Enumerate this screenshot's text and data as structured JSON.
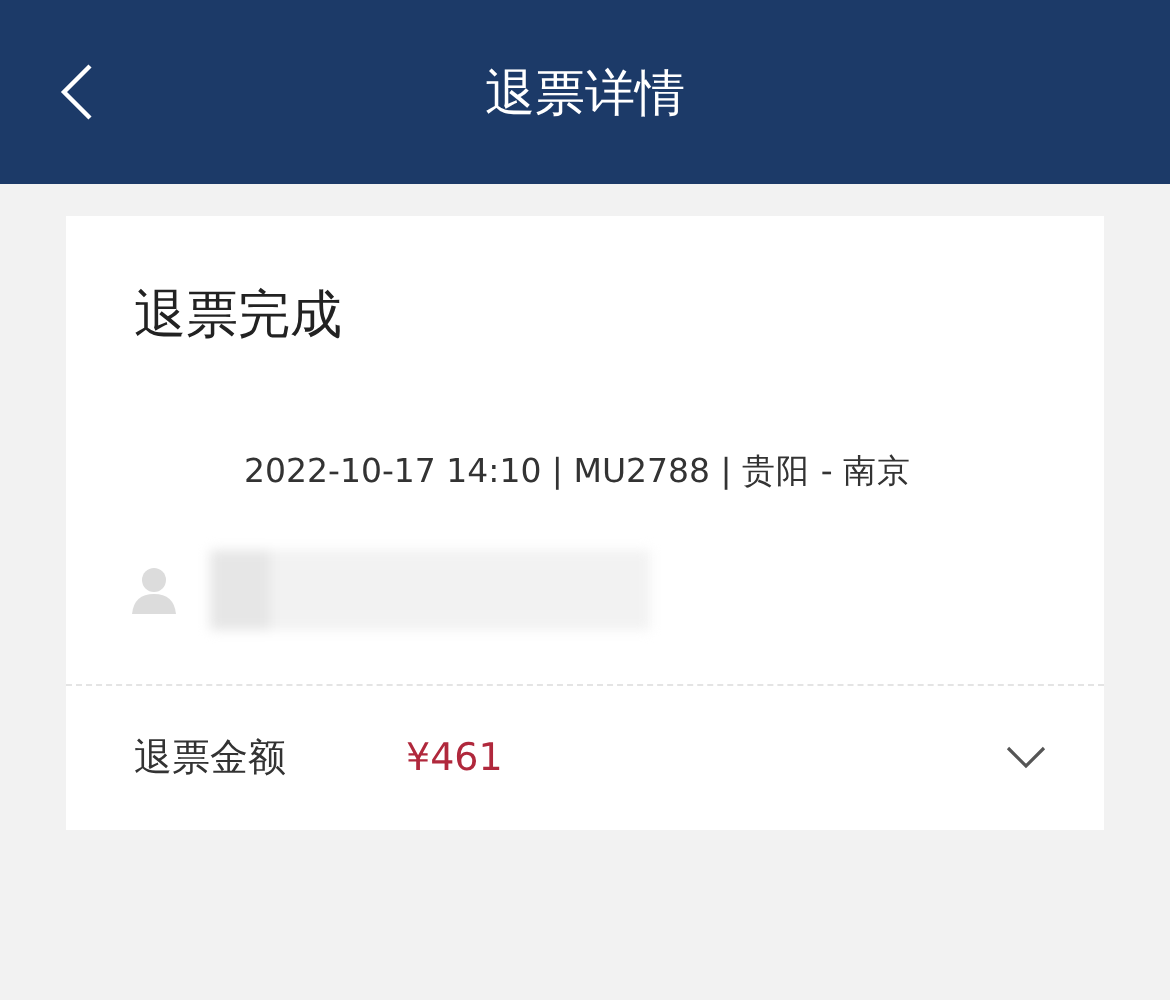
{
  "header": {
    "title": "退票详情"
  },
  "card": {
    "status": "退票完成",
    "flight_info": "2022-10-17 14:10 | MU2788 | 贵阳 - 南京",
    "refund": {
      "label": "退票金额",
      "amount": "¥461",
      "expanded": false
    }
  }
}
